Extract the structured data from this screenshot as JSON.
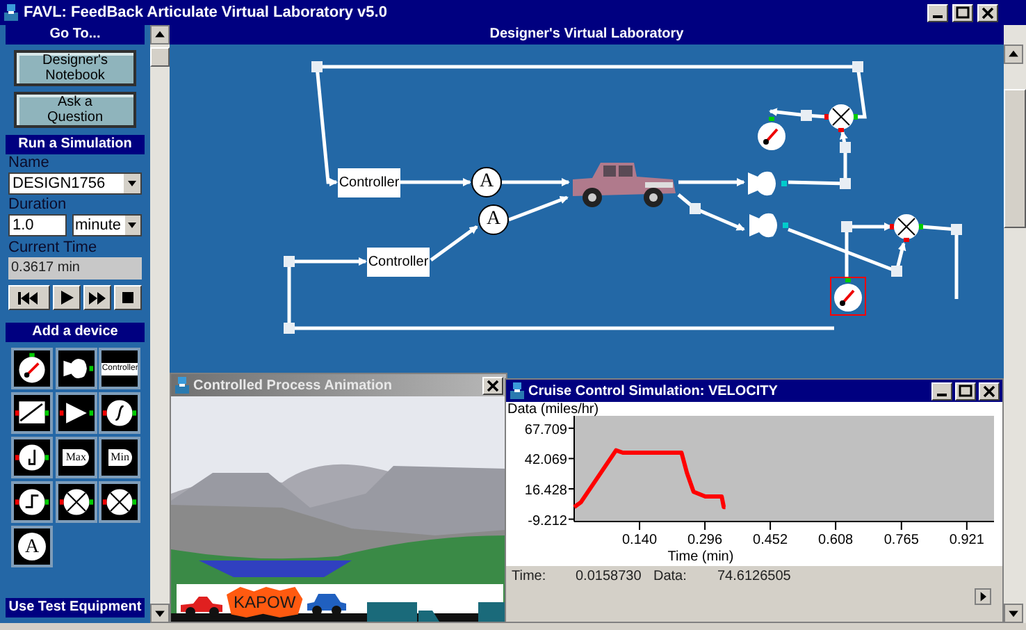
{
  "window": {
    "title": "FAVL: FeedBack Articulate Virtual Laboratory v5.0"
  },
  "sidebar": {
    "goto": {
      "title": "Go To...",
      "buttons": [
        "Designer's Notebook",
        "Ask a Question"
      ]
    },
    "simulation": {
      "title": "Run a Simulation",
      "name_label": "Name",
      "name_value": "DESIGN1756",
      "duration_label": "Duration",
      "duration_value": "1.0",
      "duration_unit": "minute",
      "current_time_label": "Current Time",
      "current_time": "0.3617 min",
      "playback": [
        {
          "kind": "rewind"
        },
        {
          "kind": "play"
        },
        {
          "kind": "forward"
        },
        {
          "kind": "stop"
        }
      ]
    },
    "devices": {
      "title": "Add a device",
      "items": [
        {
          "kind": "gauge"
        },
        {
          "kind": "sensor"
        },
        {
          "kind": "controller",
          "label": "Controller"
        },
        {
          "kind": "ramp"
        },
        {
          "kind": "amplifier"
        },
        {
          "kind": "integrator"
        },
        {
          "kind": "differentiator"
        },
        {
          "kind": "max",
          "label": "Max"
        },
        {
          "kind": "min",
          "label": "Min"
        },
        {
          "kind": "step"
        },
        {
          "kind": "sum-plus"
        },
        {
          "kind": "sum-minus"
        },
        {
          "kind": "text",
          "label": "A"
        }
      ]
    },
    "test_equipment": {
      "title": "Use Test Equipment"
    }
  },
  "designer": {
    "title": "Designer's Virtual Laboratory",
    "controllers": [
      {
        "label": "Controller"
      },
      {
        "label": "Controller"
      }
    ],
    "amplifiers": [
      {
        "label": "A"
      },
      {
        "label": "A"
      }
    ],
    "gauges": [
      {
        "selected": false
      },
      {
        "selected": true
      }
    ]
  },
  "animation": {
    "title": "Controlled Process Animation",
    "caption": "KAPOW"
  },
  "plot": {
    "title": "Cruise Control Simulation: VELOCITY",
    "status": {
      "time_label": "Time:",
      "time": "0.0158730",
      "data_label": "Data:",
      "data": "74.6126505"
    },
    "chart_data": {
      "type": "line",
      "xlabel": "Time (min)",
      "ylabel": "Data (miles/hr)",
      "xlim": [
        -0.016,
        0.986
      ],
      "ylim": [
        -11.2,
        78.2
      ],
      "xticks": [
        {
          "value": 0.14,
          "label": "0.140"
        },
        {
          "value": 0.296,
          "label": "0.296"
        },
        {
          "value": 0.452,
          "label": "0.452"
        },
        {
          "value": 0.608,
          "label": "0.608"
        },
        {
          "value": 0.765,
          "label": "0.765"
        },
        {
          "value": 0.921,
          "label": "0.921"
        }
      ],
      "yticks": [
        {
          "value": -9.212,
          "label": "-9.212"
        },
        {
          "value": 16.428,
          "label": "16.428"
        },
        {
          "value": 42.069,
          "label": "42.069"
        },
        {
          "value": 67.709,
          "label": "67.709"
        }
      ],
      "x": [
        -0.016,
        0.0,
        0.084,
        0.1,
        0.12,
        0.24,
        0.253,
        0.269,
        0.297,
        0.336,
        0.341,
        0.345
      ],
      "series": [
        {
          "color": "#ff0000",
          "values": [
            1,
            5,
            49,
            47,
            47,
            47,
            30,
            14,
            10,
            10,
            1,
            1
          ]
        }
      ]
    }
  }
}
